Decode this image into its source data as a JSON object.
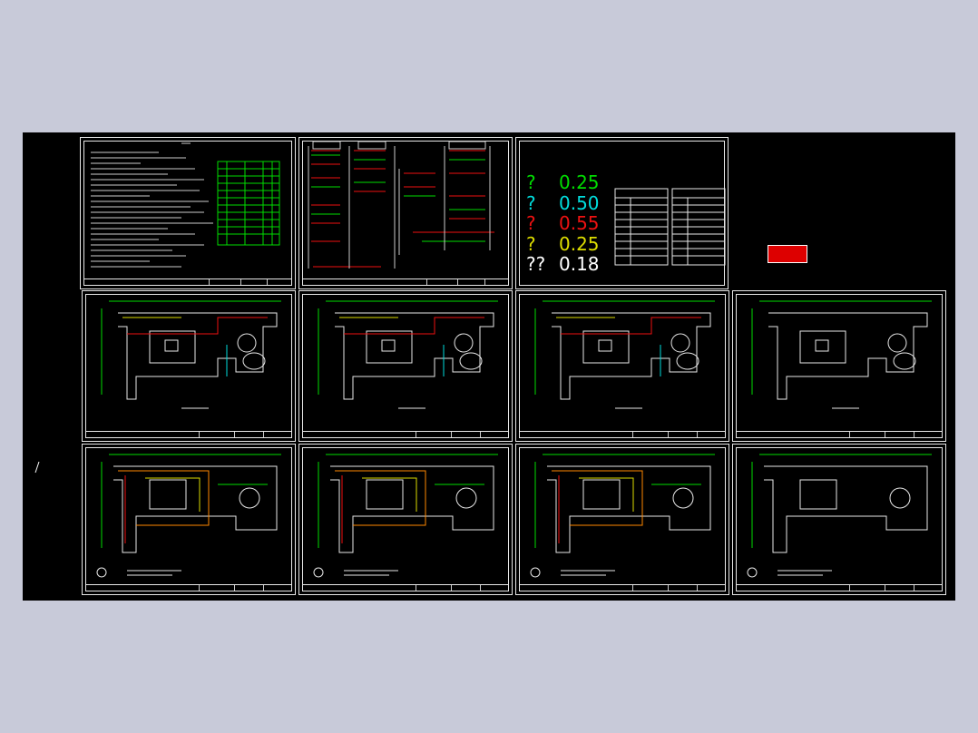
{
  "viewport": {
    "background": "#c8cad9",
    "model_space_background": "#000000"
  },
  "sheets": [
    {
      "name": "design-notes"
    },
    {
      "name": "system-diagram"
    },
    {
      "name": "lineweight-legend"
    },
    {
      "name": "floor-plan-1"
    },
    {
      "name": "floor-plan-2"
    },
    {
      "name": "floor-plan-3"
    },
    {
      "name": "floor-plan-4"
    },
    {
      "name": "piping-plan-1"
    },
    {
      "name": "piping-plan-2"
    },
    {
      "name": "piping-plan-3"
    },
    {
      "name": "piping-plan-4"
    }
  ],
  "lineweight_legend": {
    "rows": [
      {
        "marker": "?",
        "value": "0.25",
        "color": "#00dd00"
      },
      {
        "marker": "?",
        "value": "0.50",
        "color": "#00dddd"
      },
      {
        "marker": "?",
        "value": "0.55",
        "color": "#ee1111"
      },
      {
        "marker": "?",
        "value": "0.25",
        "color": "#dddd00"
      },
      {
        "marker": "??",
        "value": "0.18",
        "color": "#ffffff"
      }
    ]
  },
  "colors": {
    "green_line": "#00dd00",
    "cyan_line": "#00dddd",
    "red_line": "#ee1111",
    "yellow_line": "#dddd00",
    "white_line": "#e8e8e8",
    "orange_line": "#ff8800"
  }
}
